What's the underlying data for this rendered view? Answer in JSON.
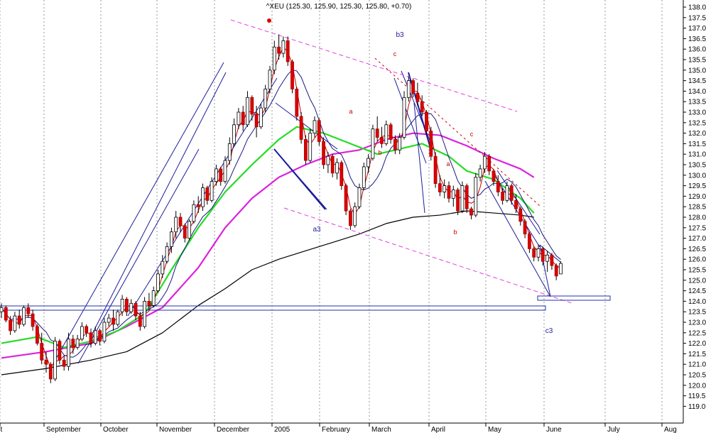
{
  "chart_data": {
    "type": "candlestick",
    "title": "^XEU (125.30, 125.90, 125.30, 125.80, +0.70)",
    "grid": true,
    "y_axis_side": "right",
    "ylim": [
      118.5,
      138.3
    ],
    "yticks": [
      119.0,
      119.5,
      120.0,
      120.5,
      121.0,
      121.5,
      122.0,
      122.5,
      123.0,
      123.5,
      124.0,
      124.5,
      125.0,
      125.5,
      126.0,
      126.5,
      127.0,
      127.5,
      128.0,
      128.5,
      129.0,
      129.5,
      130.0,
      130.5,
      131.0,
      131.5,
      132.0,
      132.5,
      133.0,
      133.5,
      134.0,
      134.5,
      135.0,
      135.5,
      136.0,
      136.5,
      137.0,
      137.5,
      138.0
    ],
    "x_month_labels": [
      "ust",
      "September",
      "October",
      "November",
      "December",
      "2005",
      "February",
      "March",
      "April",
      "May",
      "June",
      "July",
      "Aug"
    ],
    "colors": {
      "up_candle": "#ffffff",
      "down_candle": "#dd0000",
      "price_line": "#cc0000",
      "short_ma": "#1a1a80",
      "ma_green": "#22dd22",
      "ma_magenta": "#dd22dd",
      "ma_black": "#000000",
      "channel_blue": "#1c1c99",
      "channel_dashed": "#dd44dd",
      "support_box": "#2233aa",
      "grid": "#999999"
    },
    "ohlc": [
      [
        123.5,
        123.9,
        123.2,
        123.7
      ],
      [
        123.7,
        123.8,
        123.0,
        123.1
      ],
      [
        123.1,
        123.3,
        122.4,
        122.6
      ],
      [
        122.6,
        123.5,
        122.5,
        123.3
      ],
      [
        123.3,
        123.6,
        122.7,
        122.9
      ],
      [
        122.9,
        123.8,
        122.8,
        123.7
      ],
      [
        123.7,
        123.9,
        123.2,
        123.4
      ],
      [
        123.4,
        123.6,
        122.6,
        122.8
      ],
      [
        122.8,
        122.9,
        121.9,
        122.0
      ],
      [
        122.0,
        122.5,
        121.0,
        121.2
      ],
      [
        121.2,
        121.6,
        120.6,
        121.0
      ],
      [
        121.0,
        121.1,
        120.1,
        120.3
      ],
      [
        120.3,
        122.3,
        120.2,
        122.1
      ],
      [
        122.1,
        122.2,
        121.0,
        121.2
      ],
      [
        121.2,
        121.4,
        120.7,
        120.9
      ],
      [
        120.9,
        122.5,
        120.7,
        122.2
      ],
      [
        122.2,
        122.4,
        121.5,
        121.8
      ],
      [
        121.8,
        122.4,
        121.7,
        122.2
      ],
      [
        122.2,
        123.0,
        122.1,
        122.8
      ],
      [
        122.8,
        122.9,
        122.3,
        122.5
      ],
      [
        122.5,
        122.7,
        121.8,
        122.0
      ],
      [
        122.0,
        122.8,
        121.9,
        122.6
      ],
      [
        122.6,
        122.7,
        121.9,
        122.1
      ],
      [
        122.1,
        123.2,
        122.0,
        123.0
      ],
      [
        123.0,
        123.4,
        122.8,
        123.2
      ],
      [
        123.2,
        123.6,
        122.6,
        122.9
      ],
      [
        122.9,
        123.6,
        122.8,
        123.5
      ],
      [
        123.5,
        124.3,
        123.3,
        124.1
      ],
      [
        124.1,
        124.2,
        123.3,
        123.5
      ],
      [
        123.5,
        124.1,
        123.4,
        123.9
      ],
      [
        123.9,
        124.0,
        123.1,
        123.3
      ],
      [
        123.3,
        123.5,
        122.6,
        122.8
      ],
      [
        122.8,
        124.2,
        122.7,
        124.0
      ],
      [
        124.0,
        124.4,
        123.6,
        123.8
      ],
      [
        123.8,
        124.7,
        123.7,
        124.5
      ],
      [
        124.5,
        125.5,
        124.4,
        125.3
      ],
      [
        125.3,
        126.2,
        125.1,
        125.9
      ],
      [
        125.9,
        126.8,
        125.8,
        126.6
      ],
      [
        126.6,
        127.5,
        126.3,
        127.3
      ],
      [
        127.3,
        128.3,
        127.0,
        128.0
      ],
      [
        128.0,
        128.2,
        127.3,
        127.6
      ],
      [
        127.6,
        127.7,
        126.8,
        127.0
      ],
      [
        127.0,
        127.9,
        126.9,
        127.8
      ],
      [
        127.8,
        128.8,
        127.7,
        128.6
      ],
      [
        128.6,
        129.0,
        128.2,
        128.5
      ],
      [
        128.5,
        129.6,
        128.3,
        129.4
      ],
      [
        129.4,
        129.5,
        128.6,
        128.8
      ],
      [
        128.8,
        129.9,
        128.7,
        129.7
      ],
      [
        129.7,
        130.5,
        129.5,
        130.3
      ],
      [
        130.3,
        130.4,
        129.5,
        129.7
      ],
      [
        129.7,
        130.9,
        129.6,
        130.7
      ],
      [
        130.7,
        131.8,
        130.5,
        131.5
      ],
      [
        131.5,
        132.7,
        131.4,
        132.4
      ],
      [
        132.4,
        133.2,
        132.2,
        133.0
      ],
      [
        133.0,
        133.3,
        132.1,
        132.4
      ],
      [
        132.4,
        134.0,
        132.3,
        133.7
      ],
      [
        133.7,
        133.8,
        132.6,
        132.9
      ],
      [
        132.9,
        133.3,
        131.8,
        132.3
      ],
      [
        132.3,
        133.4,
        132.2,
        133.2
      ],
      [
        133.2,
        134.3,
        133.0,
        134.1
      ],
      [
        134.1,
        135.2,
        133.9,
        135.0
      ],
      [
        135.0,
        136.4,
        134.8,
        136.1
      ],
      [
        136.1,
        136.7,
        135.5,
        135.8
      ],
      [
        135.8,
        136.6,
        135.6,
        136.4
      ],
      [
        136.4,
        136.6,
        135.2,
        135.4
      ],
      [
        135.4,
        135.5,
        133.9,
        134.1
      ],
      [
        134.1,
        134.2,
        132.6,
        132.8
      ],
      [
        132.8,
        133.0,
        131.5,
        131.7
      ],
      [
        131.7,
        131.9,
        130.5,
        130.7
      ],
      [
        130.7,
        132.2,
        130.6,
        132.0
      ],
      [
        132.0,
        132.8,
        131.8,
        132.6
      ],
      [
        132.6,
        132.7,
        131.4,
        131.6
      ],
      [
        131.6,
        131.8,
        130.3,
        130.5
      ],
      [
        130.5,
        131.1,
        130.1,
        130.9
      ],
      [
        130.9,
        131.0,
        129.9,
        130.1
      ],
      [
        130.1,
        130.8,
        129.8,
        130.6
      ],
      [
        130.6,
        130.7,
        129.3,
        129.5
      ],
      [
        129.5,
        129.6,
        128.1,
        128.3
      ],
      [
        128.3,
        128.4,
        127.4,
        127.6
      ],
      [
        127.6,
        128.7,
        127.5,
        128.5
      ],
      [
        128.5,
        129.6,
        128.4,
        129.4
      ],
      [
        129.4,
        130.6,
        129.3,
        130.4
      ],
      [
        130.4,
        131.0,
        130.1,
        130.8
      ],
      [
        130.8,
        132.4,
        130.7,
        132.2
      ],
      [
        132.2,
        132.8,
        131.6,
        131.8
      ],
      [
        131.8,
        132.3,
        131.3,
        131.5
      ],
      [
        131.5,
        132.6,
        131.4,
        132.4
      ],
      [
        132.4,
        132.5,
        131.5,
        131.7
      ],
      [
        131.7,
        131.9,
        131.0,
        131.2
      ],
      [
        131.2,
        132.0,
        131.0,
        131.8
      ],
      [
        131.8,
        134.0,
        131.7,
        133.7
      ],
      [
        133.7,
        134.7,
        133.5,
        134.5
      ],
      [
        134.5,
        134.6,
        133.7,
        133.9
      ],
      [
        133.9,
        134.4,
        133.3,
        133.5
      ],
      [
        133.5,
        133.8,
        132.8,
        133.0
      ],
      [
        133.0,
        133.1,
        131.9,
        132.1
      ],
      [
        132.1,
        132.3,
        130.7,
        130.9
      ],
      [
        130.9,
        131.1,
        129.4,
        129.6
      ],
      [
        129.6,
        130.0,
        129.0,
        129.2
      ],
      [
        129.2,
        129.8,
        128.9,
        129.5
      ],
      [
        129.5,
        129.7,
        128.7,
        128.9
      ],
      [
        128.9,
        129.5,
        128.5,
        129.3
      ],
      [
        129.3,
        129.4,
        128.1,
        128.3
      ],
      [
        128.3,
        129.7,
        128.2,
        129.5
      ],
      [
        129.5,
        129.6,
        128.2,
        128.4
      ],
      [
        128.4,
        128.5,
        127.9,
        128.1
      ],
      [
        128.1,
        130.1,
        128.0,
        129.9
      ],
      [
        129.9,
        130.5,
        129.7,
        130.3
      ],
      [
        130.3,
        131.1,
        130.1,
        130.9
      ],
      [
        130.9,
        131.0,
        130.0,
        130.2
      ],
      [
        130.2,
        130.3,
        129.5,
        129.7
      ],
      [
        129.7,
        130.0,
        129.0,
        129.2
      ],
      [
        129.2,
        129.4,
        128.6,
        128.8
      ],
      [
        128.8,
        129.7,
        128.7,
        129.5
      ],
      [
        129.5,
        129.6,
        128.6,
        128.8
      ],
      [
        128.8,
        129.1,
        128.2,
        128.4
      ],
      [
        128.4,
        128.5,
        127.6,
        127.8
      ],
      [
        127.8,
        127.9,
        127.0,
        127.2
      ],
      [
        127.2,
        127.3,
        126.3,
        126.5
      ],
      [
        126.5,
        126.6,
        125.9,
        126.1
      ],
      [
        126.1,
        126.7,
        125.9,
        126.5
      ],
      [
        126.5,
        126.6,
        125.7,
        125.9
      ],
      [
        125.9,
        126.4,
        125.4,
        126.2
      ],
      [
        126.2,
        126.3,
        125.5,
        125.7
      ],
      [
        125.7,
        125.8,
        125.0,
        125.2
      ],
      [
        125.3,
        125.9,
        125.3,
        125.8
      ]
    ],
    "moving_averages": {
      "green": [
        [
          0,
          122.0
        ],
        [
          8,
          122.3
        ],
        [
          14,
          121.8
        ],
        [
          20,
          122.1
        ],
        [
          26,
          122.6
        ],
        [
          32,
          123.4
        ],
        [
          38,
          125.5
        ],
        [
          44,
          127.5
        ],
        [
          50,
          129.2
        ],
        [
          56,
          130.5
        ],
        [
          62,
          131.7
        ],
        [
          66,
          132.3
        ],
        [
          72,
          132.0
        ],
        [
          78,
          131.5
        ],
        [
          84,
          131.0
        ],
        [
          88,
          131.2
        ],
        [
          94,
          131.5
        ],
        [
          100,
          130.9
        ],
        [
          104,
          130.2
        ],
        [
          110,
          129.8
        ],
        [
          116,
          128.9
        ],
        [
          119,
          128.2
        ]
      ],
      "magenta": [
        [
          0,
          121.3
        ],
        [
          10,
          121.6
        ],
        [
          20,
          122.0
        ],
        [
          28,
          122.8
        ],
        [
          36,
          123.7
        ],
        [
          44,
          125.6
        ],
        [
          50,
          127.5
        ],
        [
          56,
          128.9
        ],
        [
          62,
          129.9
        ],
        [
          68,
          130.5
        ],
        [
          74,
          131.0
        ],
        [
          80,
          131.2
        ],
        [
          86,
          131.7
        ],
        [
          92,
          132.0
        ],
        [
          98,
          131.9
        ],
        [
          104,
          131.4
        ],
        [
          110,
          130.8
        ],
        [
          116,
          130.3
        ],
        [
          119,
          129.9
        ]
      ],
      "black": [
        [
          0,
          120.5
        ],
        [
          10,
          120.8
        ],
        [
          20,
          121.2
        ],
        [
          28,
          121.6
        ],
        [
          36,
          122.5
        ],
        [
          44,
          123.8
        ],
        [
          50,
          124.6
        ],
        [
          56,
          125.5
        ],
        [
          62,
          126.0
        ],
        [
          68,
          126.4
        ],
        [
          74,
          126.8
        ],
        [
          80,
          127.2
        ],
        [
          86,
          127.7
        ],
        [
          92,
          128.0
        ],
        [
          98,
          128.1
        ],
        [
          104,
          128.3
        ],
        [
          110,
          128.2
        ],
        [
          116,
          128.1
        ],
        [
          119,
          128.0
        ]
      ]
    },
    "wave_labels": [
      {
        "text": "b3",
        "color": "blue"
      },
      {
        "text": "c",
        "color": "red"
      },
      {
        "text": "a",
        "color": "red"
      },
      {
        "text": "b",
        "color": "red"
      },
      {
        "text": "a3",
        "color": "blue"
      },
      {
        "text": "c",
        "color": "red"
      },
      {
        "text": "a",
        "color": "red"
      },
      {
        "text": "b",
        "color": "red"
      },
      {
        "text": "c3",
        "color": "blue"
      }
    ]
  }
}
